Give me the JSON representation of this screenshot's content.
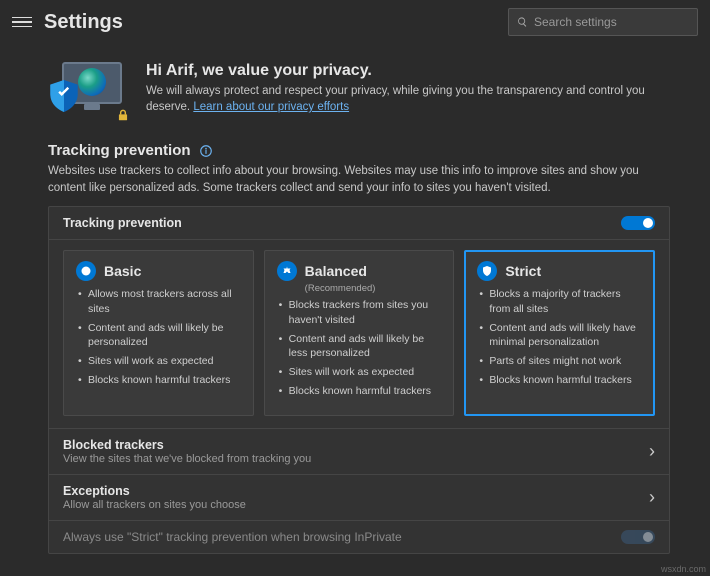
{
  "header": {
    "title": "Settings",
    "search_placeholder": "Search settings"
  },
  "hero": {
    "title": "Hi Arif, we value your privacy.",
    "body": "We will always protect and respect your privacy, while giving you the transparency and control you deserve. ",
    "link": "Learn about our privacy efforts"
  },
  "section": {
    "title": "Tracking prevention",
    "description": "Websites use trackers to collect info about your browsing. Websites may use this info to improve sites and show you content like personalized ads. Some trackers collect and send your info to sites you haven't visited."
  },
  "panel": {
    "master_label": "Tracking prevention",
    "levels": [
      {
        "key": "basic",
        "title": "Basic",
        "recommended": "",
        "bullets": [
          "Allows most trackers across all sites",
          "Content and ads will likely be personalized",
          "Sites will work as expected",
          "Blocks known harmful trackers"
        ]
      },
      {
        "key": "balanced",
        "title": "Balanced",
        "recommended": "(Recommended)",
        "bullets": [
          "Blocks trackers from sites you haven't visited",
          "Content and ads will likely be less personalized",
          "Sites will work as expected",
          "Blocks known harmful trackers"
        ]
      },
      {
        "key": "strict",
        "title": "Strict",
        "recommended": "",
        "bullets": [
          "Blocks a majority of trackers from all sites",
          "Content and ads will likely have minimal personalization",
          "Parts of sites might not work",
          "Blocks known harmful trackers"
        ]
      }
    ],
    "selected_level": "strict",
    "blocked": {
      "label": "Blocked trackers",
      "sub": "View the sites that we've blocked from tracking you"
    },
    "exceptions": {
      "label": "Exceptions",
      "sub": "Allow all trackers on sites you choose"
    },
    "inprivate": {
      "label": "Always use \"Strict\" tracking prevention when browsing InPrivate"
    }
  },
  "watermark": "wsxdn.com",
  "colors": {
    "accent": "#0078d4",
    "link": "#6cb2f0",
    "select": "#2296f3"
  }
}
